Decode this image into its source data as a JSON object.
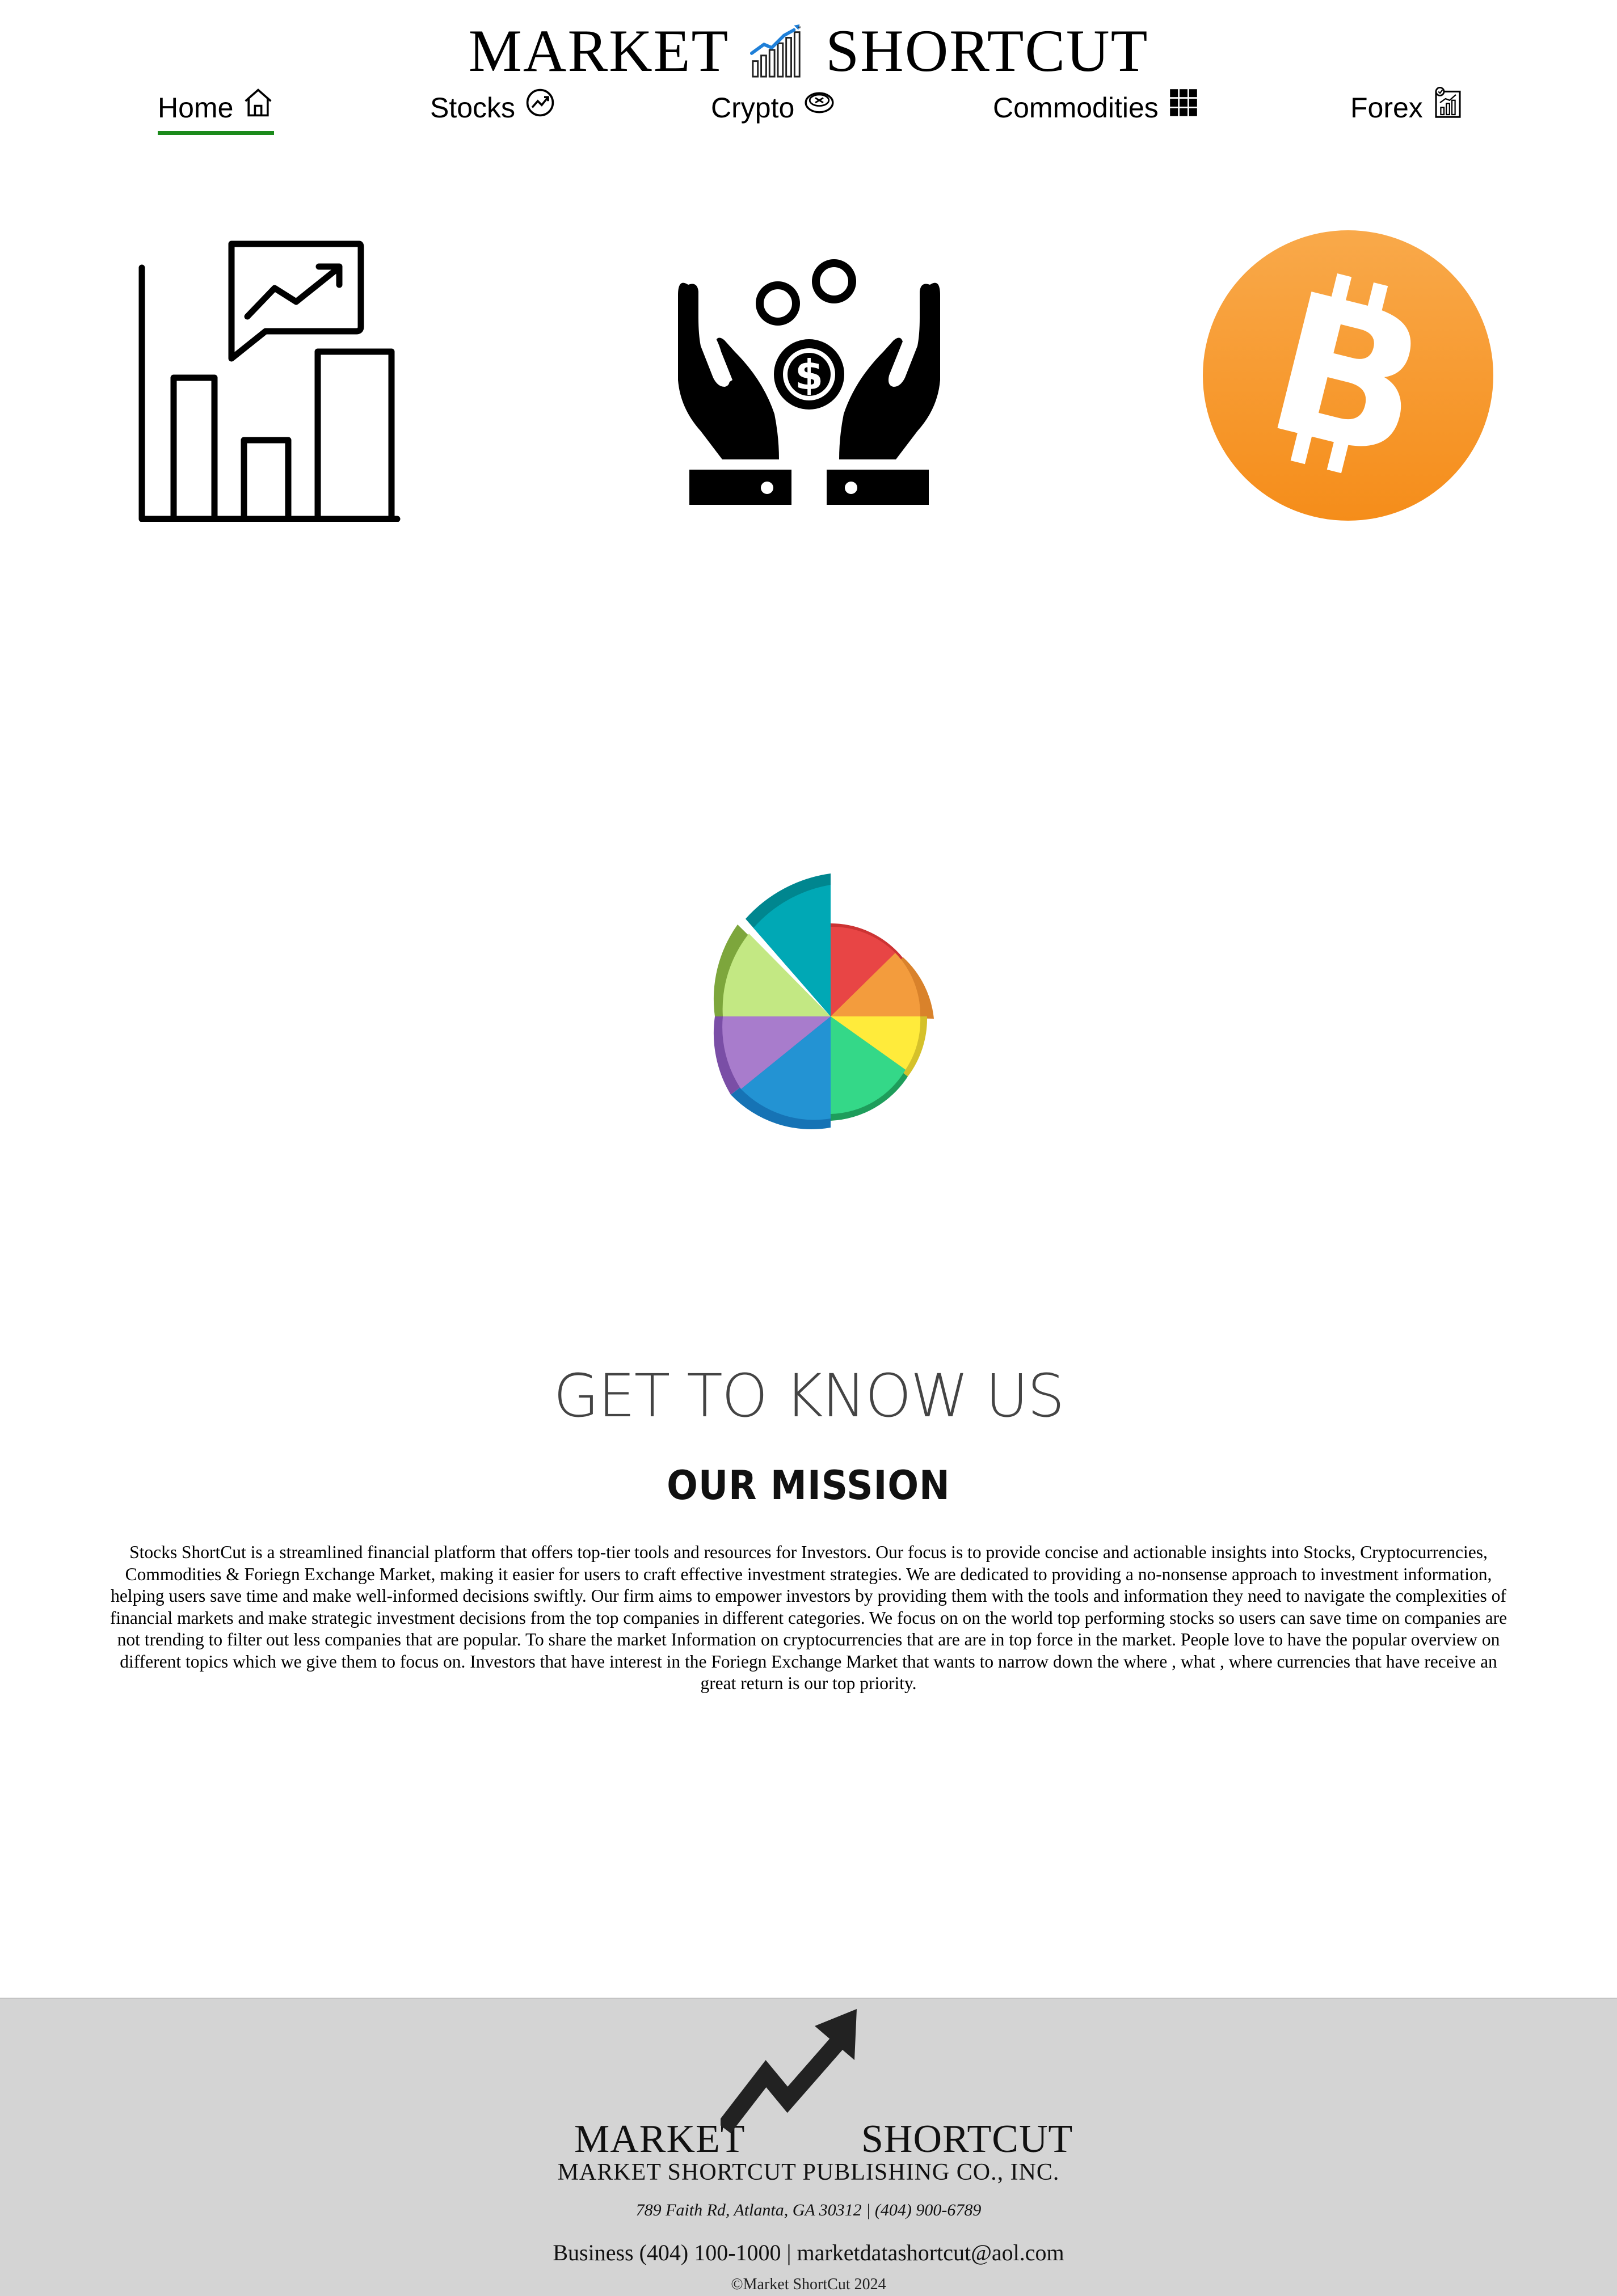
{
  "header": {
    "title_left": "MARKET",
    "title_right": "SHORTCUT",
    "logo_icon": "bar-chart-growth-icon"
  },
  "nav": {
    "items": [
      {
        "label": "Home",
        "icon": "home-icon",
        "active": true
      },
      {
        "label": "Stocks",
        "icon": "trend-circle-icon",
        "active": false
      },
      {
        "label": "Crypto",
        "icon": "coin-icon",
        "active": false
      },
      {
        "label": "Commodities",
        "icon": "grid-icon",
        "active": false
      },
      {
        "label": "Forex",
        "icon": "chart-document-icon",
        "active": false
      }
    ],
    "active_underline_color": "#1b8a1b"
  },
  "hero_icons": [
    "analytics-chart-icon",
    "investment-hands-icon",
    "bitcoin-icon",
    "colorful-pie-icon"
  ],
  "about": {
    "heading": "GET TO KNOW US",
    "subheading": "OUR MISSION",
    "body": "Stocks ShortCut is a streamlined financial platform that offers top-tier tools and resources for Investors. Our focus is to provide concise and actionable insights into Stocks, Cryptocurrencies, Commodities & Foriegn Exchange Market, making it easier for users to craft effective investment strategies. We are dedicated to providing a no-nonsense approach to investment information, helping users save time and make well-informed decisions swiftly. Our firm aims to empower investors by providing them with the tools and information they need to navigate the complexities of financial markets and make strategic investment decisions from the top companies in different categories. We focus on on the world top performing stocks so users can save time on companies are not trending to filter out less companies that are popular. To share the market Information on cryptocurrencies that are are in top force in the market. People love to have the popular overview on different topics which we give them to focus on. Investors that have interest in the Foriegn Exchange Market that wants to narrow down the where , what , where currencies that have receive an great return is our top priority."
  },
  "footer": {
    "logo_left": "MARKET",
    "logo_right": "SHORTCUT",
    "company": "MARKET SHORTCUT PUBLISHING CO., INC.",
    "address": "789 Faith Rd, Atlanta, GA 30312 | (404) 900-6789",
    "contact": "Business (404) 100-1000 | marketdatashortcut@aol.com",
    "copyright": "©Market ShortCut 2024",
    "background": "#d4d4d4"
  },
  "colors": {
    "bitcoin_orange": "#f7931a",
    "pie": [
      "#00a8b5",
      "#e84545",
      "#f39c3d",
      "#ffeb3b",
      "#34d888",
      "#2393d3",
      "#a87ccc",
      "#c3e883"
    ]
  }
}
